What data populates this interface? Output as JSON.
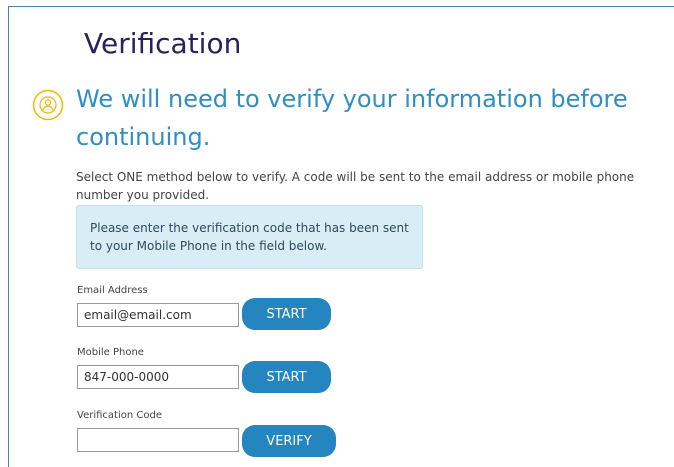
{
  "page": {
    "title": "Verification",
    "headline": "We will need to verify your information before continuing.",
    "instructions": "Select ONE method below to verify. A code will be sent to the email address or mobile phone number you provided.",
    "notice": "Please enter the verification code that has been sent to your Mobile Phone in the field below."
  },
  "form": {
    "email": {
      "label": "Email Address",
      "value": "email@email.com",
      "button": "START"
    },
    "phone": {
      "label": "Mobile Phone",
      "value": "847-000-0000",
      "button": "START"
    },
    "code": {
      "label": "Verification Code",
      "value": "",
      "button": "VERIFY"
    }
  },
  "icons": {
    "header_icon": "user-circle-icon"
  },
  "colors": {
    "title": "#2b1f5c",
    "headline": "#2f8fc2",
    "icon": "#f2b705",
    "notice_bg": "#d8edf6",
    "button": "#2585bf",
    "frame_border": "#4a7fb5"
  }
}
